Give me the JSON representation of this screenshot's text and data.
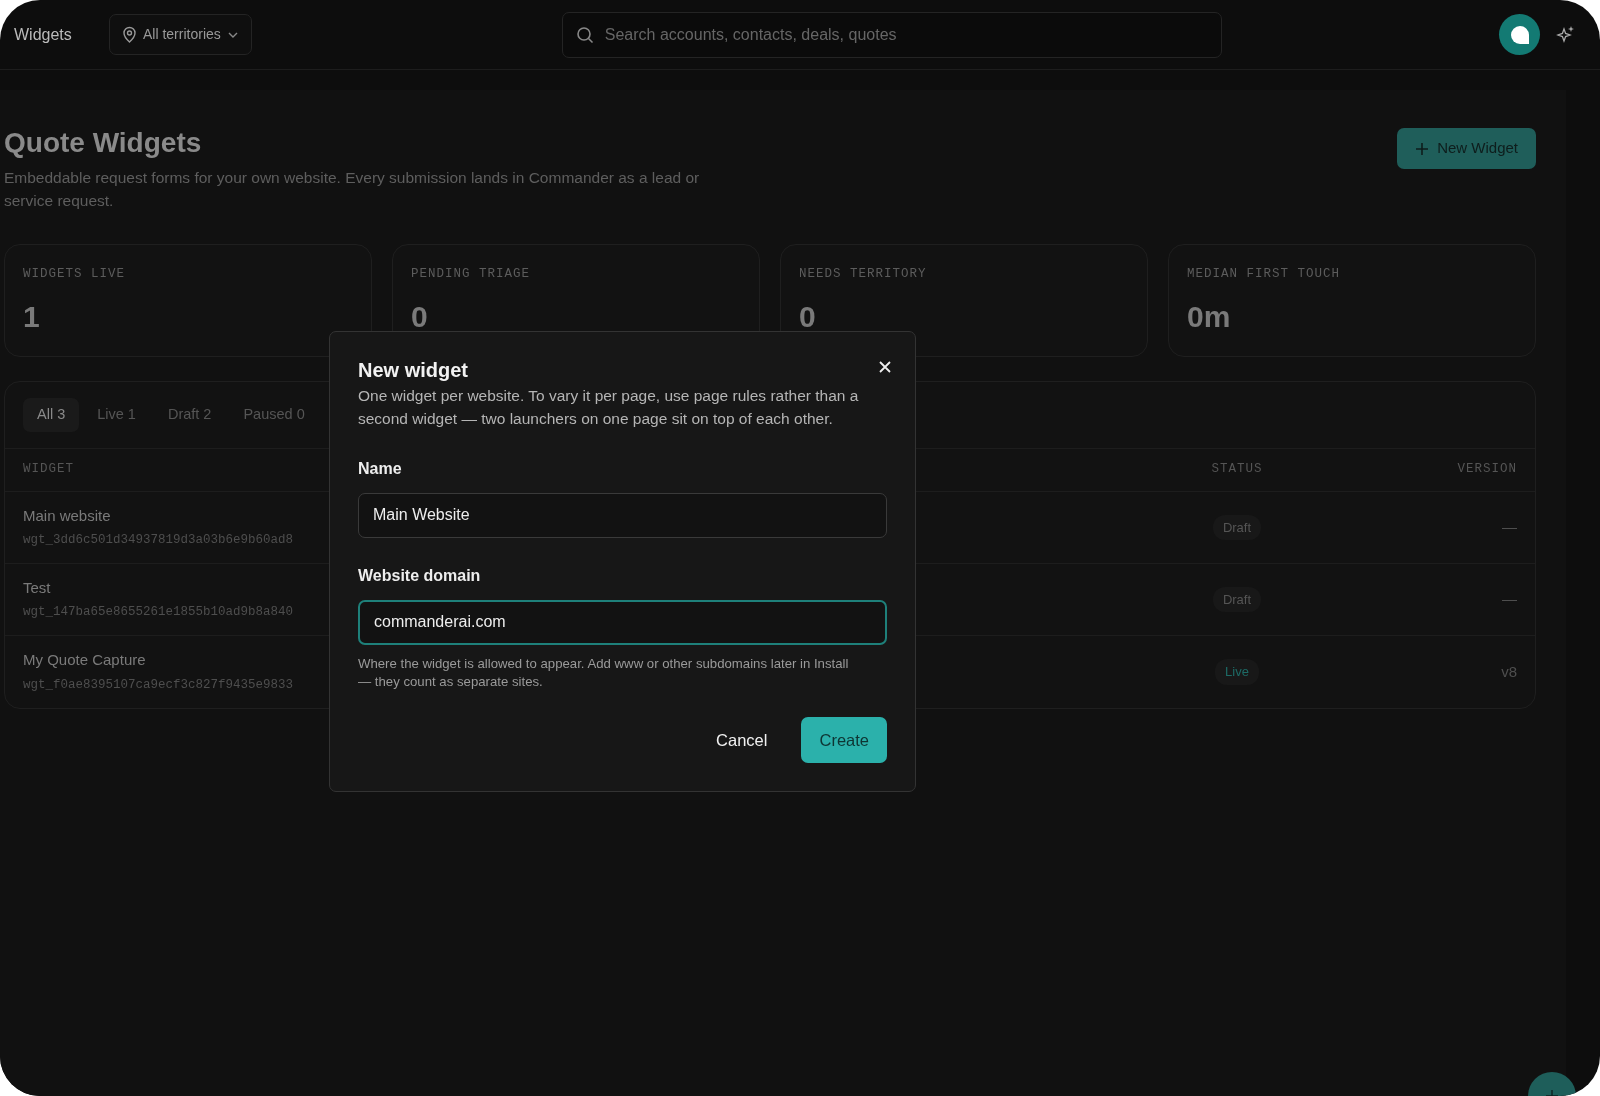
{
  "topbar": {
    "title": "Widgets",
    "territory": "All territories",
    "search": {
      "placeholder": "Search accounts, contacts, deals, quotes"
    }
  },
  "page": {
    "title": "Quote Widgets",
    "subtitle": "Embeddable request forms for your own website. Every submission lands in Commander as a lead or service request.",
    "new_button": "New Widget"
  },
  "stats": [
    {
      "label": "WIDGETS LIVE",
      "value": "1"
    },
    {
      "label": "PENDING TRIAGE",
      "value": "0"
    },
    {
      "label": "NEEDS TERRITORY",
      "value": "0"
    },
    {
      "label": "MEDIAN FIRST TOUCH",
      "value": "0m"
    }
  ],
  "tabs": [
    {
      "label": "All 3",
      "selected": true
    },
    {
      "label": "Live 1",
      "selected": false
    },
    {
      "label": "Draft 2",
      "selected": false
    },
    {
      "label": "Paused 0",
      "selected": false
    }
  ],
  "table": {
    "columns": [
      "WIDGET",
      "STATUS",
      "VERSION"
    ],
    "rows": [
      {
        "name": "Main website",
        "id": "wgt_3dd6c501d34937819d3a03b6e9b60ad8",
        "status": "Draft",
        "kind": "draft",
        "version": "—"
      },
      {
        "name": "Test",
        "id": "wgt_147ba65e8655261e1855b10ad9b8a840",
        "status": "Draft",
        "kind": "draft",
        "version": "—"
      },
      {
        "name": "My Quote Capture",
        "id": "wgt_f0ae8395107ca9ecf3c827f9435e9833",
        "status": "Live",
        "kind": "live",
        "version": "v8"
      }
    ]
  },
  "modal": {
    "title": "New widget",
    "description": "One widget per website. To vary it per page, use page rules rather than a second widget — two launchers on one page sit on top of each other.",
    "fields": [
      {
        "label": "Name",
        "value": "Main Website",
        "focused": false
      },
      {
        "label": "Website domain",
        "value": "commanderai.com",
        "focused": true,
        "hint": "Where the widget is allowed to appear. Add www or other subdomains later in Install — they count as separate sites."
      }
    ],
    "cancel": "Cancel",
    "create": "Create"
  }
}
